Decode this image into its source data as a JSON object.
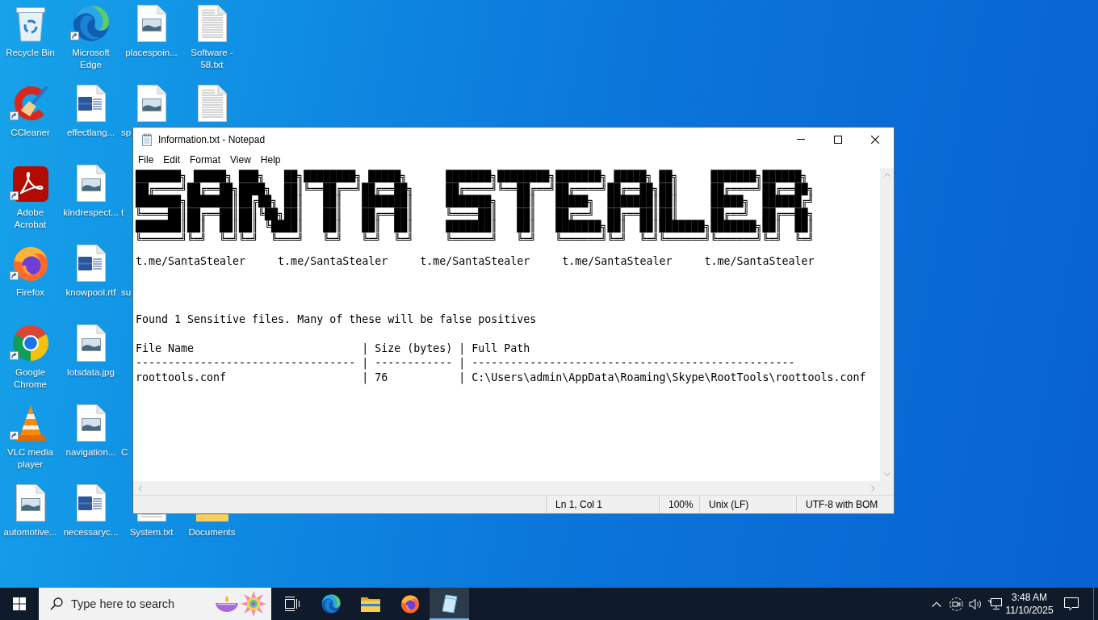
{
  "desktop": {
    "rows": [
      [
        {
          "kind": "recycle-bin",
          "label": "Recycle Bin",
          "shortcut": false,
          "cut_off": false
        },
        {
          "kind": "edge",
          "label": "Microsoft Edge",
          "shortcut": true,
          "cut_off": false
        },
        {
          "kind": "image-file",
          "label": "placespoin...",
          "shortcut": false,
          "cut_off": false
        },
        {
          "kind": "text-file",
          "label": "Software - 58.txt",
          "shortcut": false,
          "cut_off": false
        }
      ],
      [
        {
          "kind": "ccleaner",
          "label": "CCleaner",
          "shortcut": true,
          "cut_off": false
        },
        {
          "kind": "word-doc",
          "label": "effectlang...",
          "shortcut": false,
          "cut_off": false
        },
        {
          "kind": "image-file",
          "label": "sp",
          "shortcut": false,
          "cut_off": true
        },
        {
          "kind": "text-file",
          "shortcut": false
        }
      ],
      [
        {
          "kind": "acrobat",
          "label": "Adobe Acrobat",
          "shortcut": true,
          "cut_off": false
        },
        {
          "kind": "image-file",
          "label": "kindrespect...",
          "shortcut": false,
          "cut_off": false
        },
        {
          "label": "t",
          "cut_off": true
        }
      ],
      [
        {
          "kind": "firefox",
          "label": "Firefox",
          "shortcut": true,
          "cut_off": false
        },
        {
          "kind": "word-doc",
          "label": "knowpool.rtf",
          "shortcut": false,
          "cut_off": false
        },
        {
          "label": "su",
          "cut_off": true
        }
      ],
      [
        {
          "kind": "chrome",
          "label": "Google Chrome",
          "shortcut": true,
          "cut_off": false
        },
        {
          "kind": "image-file",
          "label": "lotsdata.jpg",
          "shortcut": false,
          "cut_off": false
        }
      ],
      [
        {
          "kind": "vlc",
          "label": "VLC media player",
          "shortcut": true,
          "cut_off": false
        },
        {
          "kind": "image-file",
          "label": "navigation...",
          "shortcut": false,
          "cut_off": false
        },
        {
          "label": "C",
          "cut_off": true
        }
      ],
      [
        {
          "kind": "image-file",
          "label": "automotive...",
          "shortcut": false,
          "cut_off": false
        },
        {
          "kind": "word-doc",
          "label": "necessaryc...",
          "shortcut": false,
          "cut_off": false
        },
        {
          "kind": "text-file",
          "label": "System.txt",
          "shortcut": false,
          "cut_off": false,
          "icon_cut_off": true
        },
        {
          "kind": "folder",
          "label": "Documents",
          "shortcut": false,
          "cut_off": false,
          "icon_cut_off": true
        }
      ]
    ]
  },
  "notepad": {
    "title": "Information.txt - Notepad",
    "menu": [
      "File",
      "Edit",
      "Format",
      "View",
      "Help"
    ],
    "document": {
      "banner": [
        "███████╗ █████╗ ███╗   ██╗████████╗ █████╗      ███████╗████████╗███████╗ █████╗ ██╗     ███████╗██████╗ ",
        "██╔════╝██╔══██╗████╗  ██║╚══██╔══╝██╔══██╗     ██╔════╝╚══██╔══╝██╔════╝██╔══██╗██║     ██╔════╝██╔══██╗",
        "███████╗███████║██╔██╗ ██║   ██║   ███████║     ███████╗   ██║   █████╗  ███████║██║     █████╗  ██████╔╝",
        "╚════██║██╔══██║██║╚██╗██║   ██║   ██╔══██║     ╚════██║   ██║   ██╔══╝  ██╔══██║██║     ██╔══╝  ██╔══██╗",
        "███████║██║  ██║██║ ╚████║   ██║   ██║  ██║     ███████║   ██║   ███████╗██║  ██║███████╗███████╗██║  ██║",
        "╚══════╝╚═╝  ╚═╝╚═╝  ╚═══╝   ╚═╝   ╚═╝  ╚═╝     ╚══════╝   ╚═╝   ╚══════╝╚═╝  ╚═╝╚══════╝╚══════╝╚═╝  ╚═╝"
      ],
      "links": [
        "t.me/SantaStealer",
        "t.me/SantaStealer",
        "t.me/SantaStealer",
        "t.me/SantaStealer",
        "t.me/SantaStealer"
      ],
      "summary": "Found 1 Sensitive files. Many of these will be false positives",
      "table": {
        "header": [
          "File Name",
          "|",
          "Size (bytes)",
          "|",
          "Full Path"
        ],
        "rule": [
          "----------------------------------",
          "|",
          "------------",
          "|",
          "--------------------------------------------------"
        ],
        "rows": [
          [
            "roottools.conf",
            "|",
            "76",
            "|",
            "C:\\Users\\admin\\AppData\\Roaming\\Skype\\RootTools\\roottools.conf"
          ]
        ]
      }
    },
    "status_bar": [
      "Ln 1, Col 1",
      "100%",
      "Unix (LF)",
      "UTF-8 with BOM"
    ]
  },
  "taskbar": {
    "search": {
      "placeholder": "Type here to search"
    },
    "apps": [
      {
        "kind": "task-view",
        "selected": false
      },
      {
        "kind": "edge",
        "selected": false
      },
      {
        "kind": "file-explorer",
        "selected": false
      },
      {
        "kind": "firefox",
        "selected": false
      },
      {
        "kind": "notepad",
        "selected": true
      }
    ],
    "clock": {
      "time": "3:48 AM",
      "date": "11/10/2025"
    }
  }
}
